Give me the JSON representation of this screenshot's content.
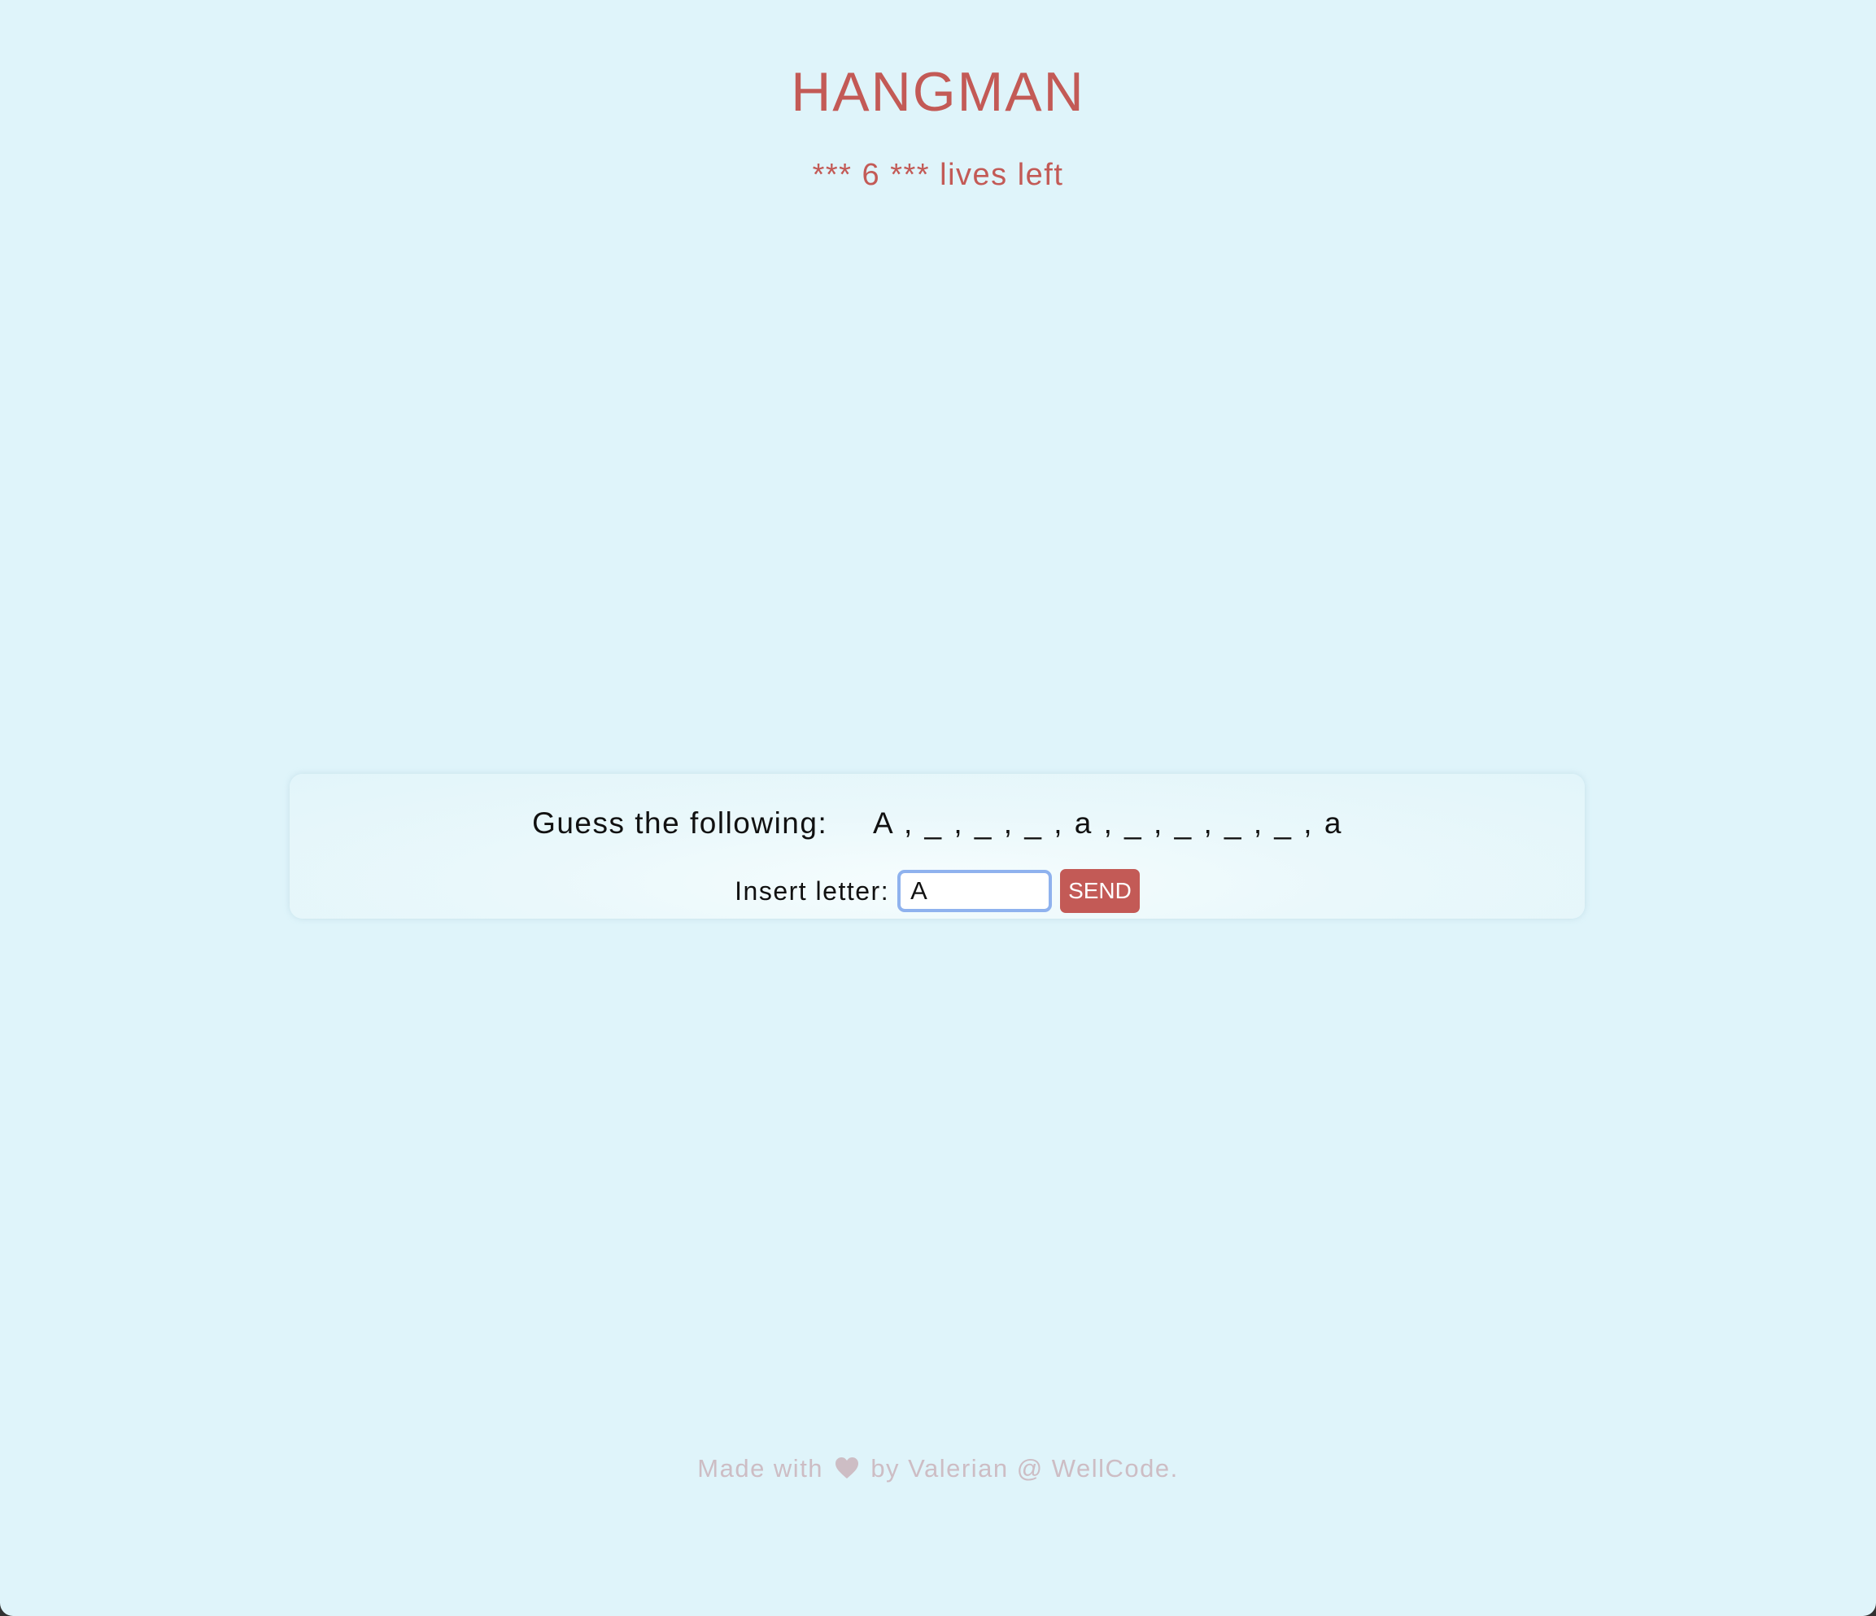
{
  "header": {
    "title": "HANGMAN",
    "lives_text": "*** 6 *** lives left"
  },
  "game": {
    "guess_label": "Guess the following:",
    "word_pattern": "A , _ , _ , _ , a , _ , _ , _ , _ , a",
    "insert_label": "Insert letter:",
    "letter_input_value": "A",
    "send_label": "SEND"
  },
  "footer": {
    "text_before": "Made with",
    "icon": "heart-icon",
    "text_after": "by Valerian @ WellCode."
  },
  "colors": {
    "background": "#dff4fa",
    "accent": "#c35a56",
    "input_focus_border": "#8fb2ee",
    "footer_text": "#cdbdc4"
  }
}
